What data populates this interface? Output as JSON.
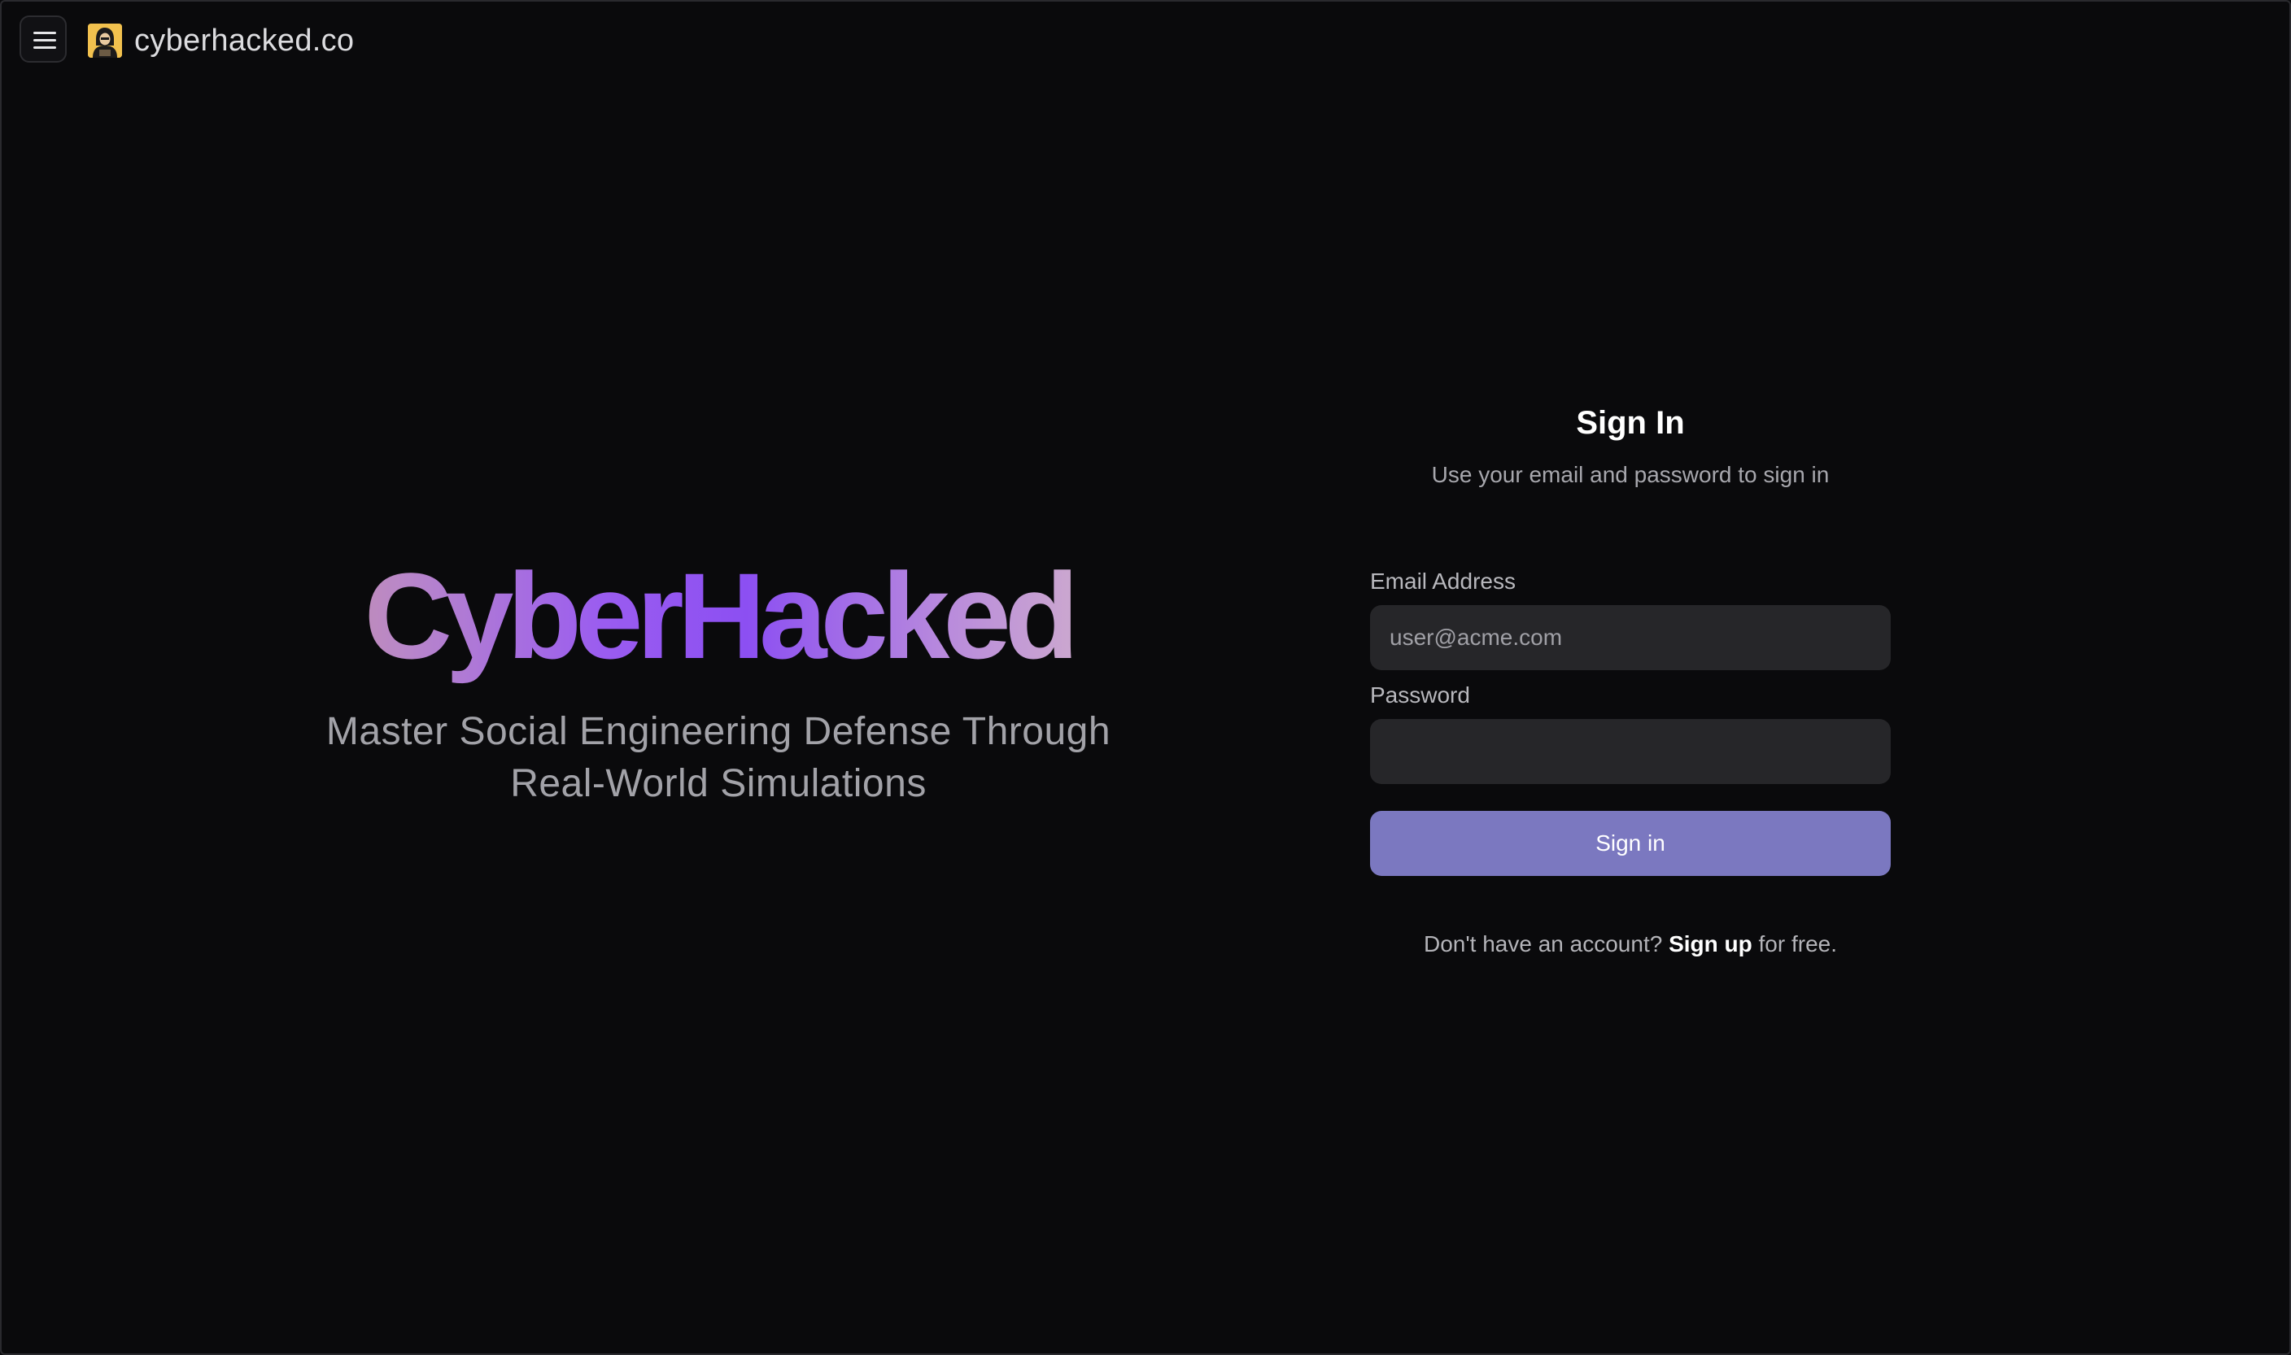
{
  "header": {
    "menu_icon": "hamburger-menu-icon",
    "logo_icon": "hooded-hacker-icon",
    "site_name": "cyberhacked.co"
  },
  "hero": {
    "title": "CyberHacked",
    "subtitle_line1": "Master Social Engineering Defense Through",
    "subtitle_line2": "Real-World Simulations"
  },
  "signin": {
    "title": "Sign In",
    "subtitle": "Use your email and password to sign in",
    "email_label": "Email Address",
    "email_placeholder": "user@acme.com",
    "email_value": "",
    "password_label": "Password",
    "password_placeholder": "",
    "password_value": "",
    "button_label": "Sign in",
    "signup_prefix": "Don't have an account?",
    "signup_link": "Sign up",
    "signup_suffix": "for free."
  },
  "colors": {
    "background": "#0a0a0c",
    "button": "#7b78c0",
    "input_bg": "#262629",
    "logo_bg": "#f2c14e"
  }
}
